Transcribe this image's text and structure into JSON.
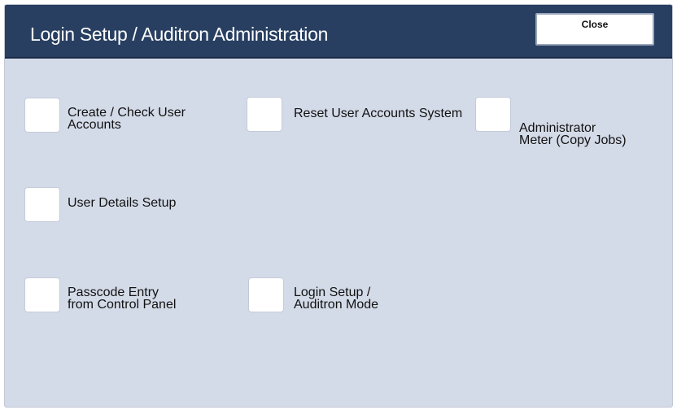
{
  "header": {
    "title": "Login Setup / Auditron Administration",
    "close_label": "Close"
  },
  "options": {
    "create_check": "Create / Check User\nAccounts",
    "reset": "Reset User Accounts System",
    "meter": "Administrator\nMeter (Copy Jobs)",
    "details": "User Details Setup",
    "passcode": "Passcode Entry\nfrom Control Panel",
    "login_mode": "Login Setup /\nAuditron Mode"
  },
  "colors": {
    "header_bg": "#283f61",
    "panel_bg": "#d4dbe8"
  }
}
